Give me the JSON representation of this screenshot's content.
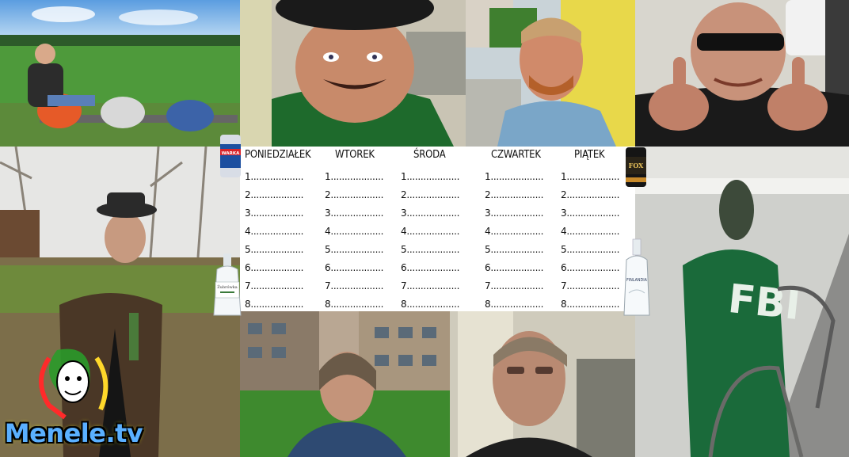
{
  "schedule": {
    "days": [
      {
        "name": "PONIEDZIAŁEK",
        "slots": [
          "1...................",
          "2...................",
          "3...................",
          "4...................",
          "5...................",
          "6...................",
          "7...................",
          "8..................."
        ]
      },
      {
        "name": "WTOREK",
        "slots": [
          "1...................",
          "2...................",
          "3...................",
          "4...................",
          "5...................",
          "6...................",
          "7...................",
          "8..................."
        ]
      },
      {
        "name": "ŚRODA",
        "slots": [
          "1...................",
          "2...................",
          "3...................",
          "4...................",
          "5...................",
          "6...................",
          "7...................",
          "8..................."
        ]
      },
      {
        "name": "CZWARTEK",
        "slots": [
          "1...................",
          "2...................",
          "3...................",
          "4...................",
          "5...................",
          "6...................",
          "7...................",
          "8..................."
        ]
      },
      {
        "name": "PIĄTEK",
        "slots": [
          "1...................",
          "2...................",
          "3...................",
          "4...................",
          "5...................",
          "6...................",
          "7...................",
          "8..................."
        ]
      }
    ]
  },
  "logo": {
    "text": "Menele.tv"
  },
  "jacket_text": "FBI",
  "bottles": {
    "can_left": "WARKA",
    "can_right": "FOX",
    "vodka_left": "Żubrówka",
    "vodka_right": "FINLANDIA"
  },
  "colors": {
    "grass": "#4c8a3a",
    "sky": "#8fc4ec",
    "shirt_green": "#1f7a3a",
    "logo_blue": "#5ab0ff"
  }
}
